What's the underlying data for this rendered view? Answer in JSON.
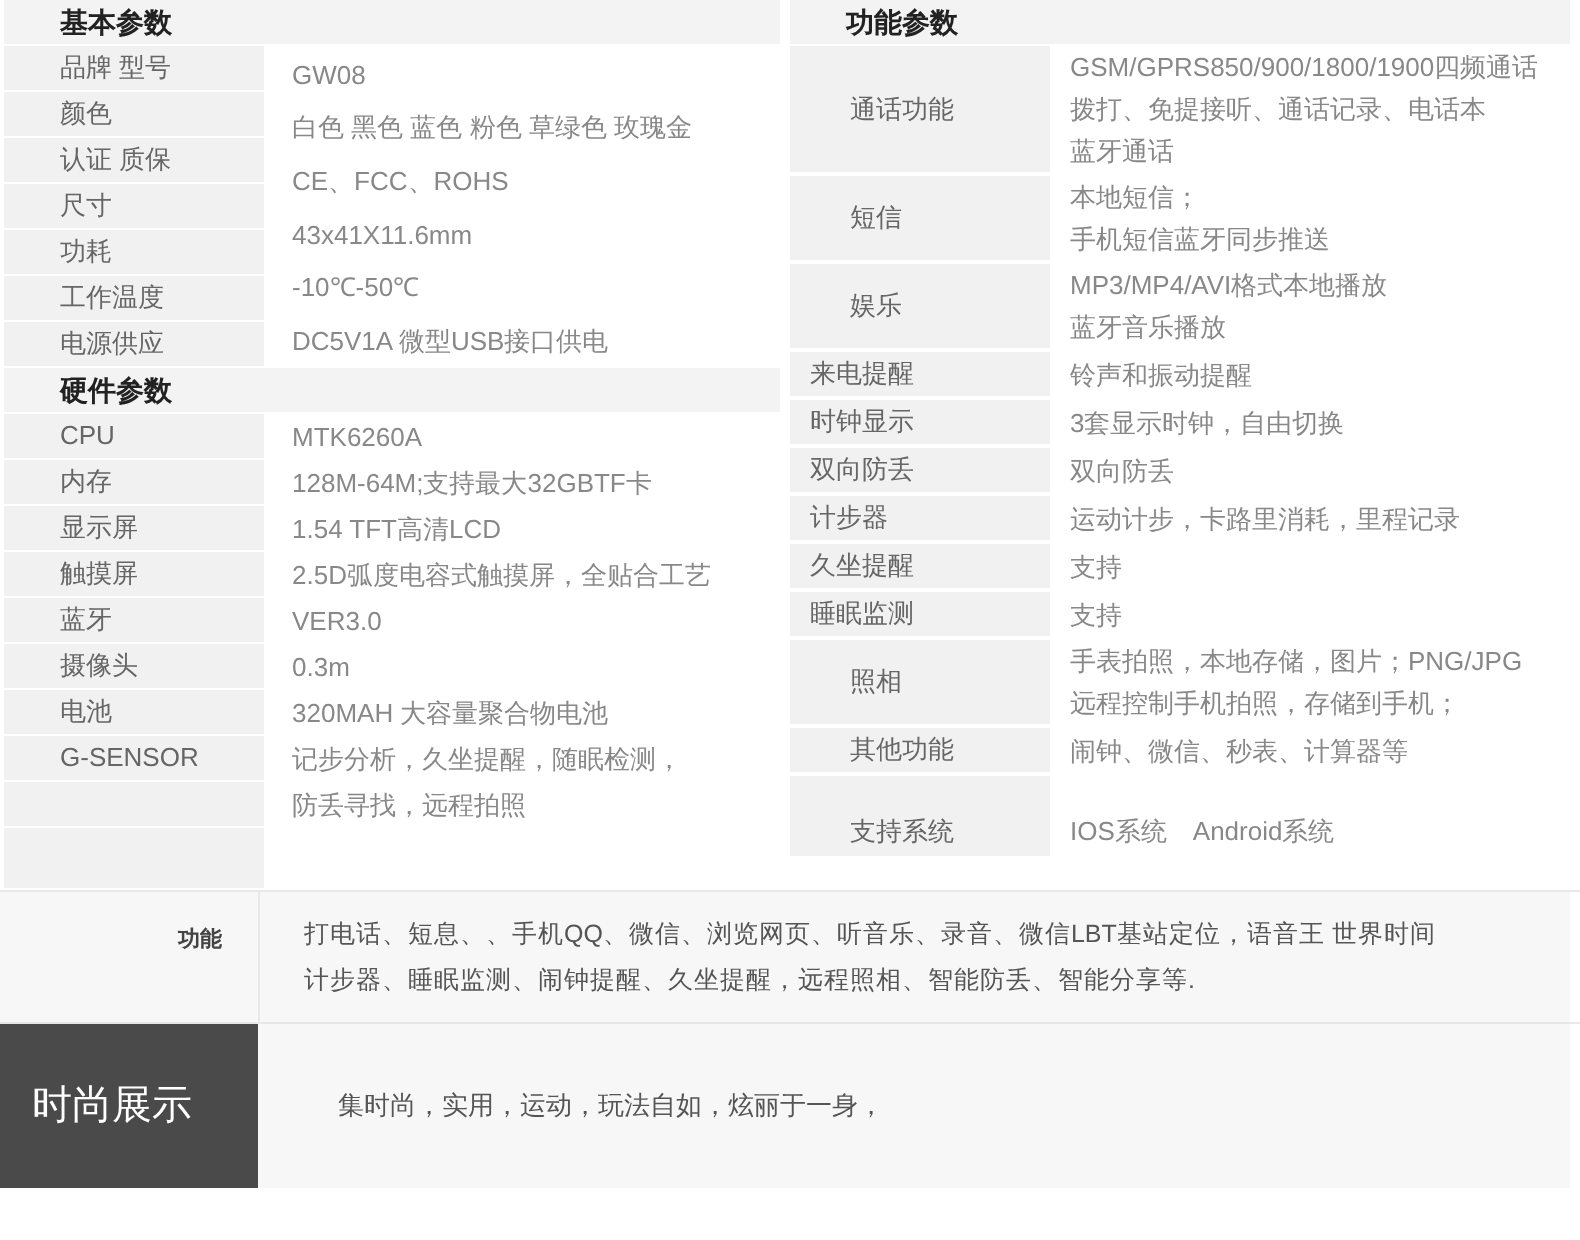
{
  "basic": {
    "title": "基本参数",
    "labels": [
      "品牌 型号",
      "颜色",
      "认证 质保",
      "尺寸",
      "功耗",
      "工作温度",
      "电源供应"
    ],
    "values": [
      "GW08",
      "白色 黑色 蓝色 粉色 草绿色 玫瑰金",
      "CE、FCC、ROHS",
      "43x41X11.6mm",
      "-10℃-50℃",
      "DC5V1A 微型USB接口供电"
    ]
  },
  "hardware": {
    "title": "硬件参数",
    "rows": [
      {
        "label": "CPU",
        "lines": [
          "MTK6260A"
        ]
      },
      {
        "label": "内存",
        "lines": [
          "128M-64M;支持最大32GBTF卡"
        ]
      },
      {
        "label": "显示屏",
        "lines": [
          "1.54 TFT高清LCD"
        ]
      },
      {
        "label": "触摸屏",
        "lines": [
          "2.5D弧度电容式触摸屏，全贴合工艺"
        ]
      },
      {
        "label": "蓝牙",
        "lines": [
          "VER3.0"
        ]
      },
      {
        "label": "摄像头",
        "lines": [
          "0.3m"
        ]
      },
      {
        "label": "电池",
        "lines": [
          "320MAH 大容量聚合物电池"
        ]
      },
      {
        "label": "G-SENSOR",
        "lines": [
          "记步分析，久坐提醒，随眠检测，",
          "防丢寻找，远程拍照"
        ]
      }
    ]
  },
  "functions": {
    "title": "功能参数",
    "rows": [
      {
        "kind": "tall",
        "label": "通话功能",
        "lines": [
          "GSM/GPRS850/900/1800/1900四频通话",
          "拨打、免提接听、通话记录、电话本",
          "蓝牙通话"
        ]
      },
      {
        "kind": "tall",
        "label": "短信",
        "lines": [
          "本地短信；",
          "手机短信蓝牙同步推送"
        ]
      },
      {
        "kind": "tall",
        "label": "娱乐",
        "lines": [
          "MP3/MP4/AVI格式本地播放",
          "蓝牙音乐播放"
        ]
      },
      {
        "kind": "compact",
        "label": "来电提醒",
        "lines": [
          "铃声和振动提醒"
        ]
      },
      {
        "kind": "compact",
        "label": "时钟显示",
        "lines": [
          "3套显示时钟，自由切换"
        ]
      },
      {
        "kind": "compact",
        "label": "双向防丢",
        "lines": [
          "双向防丢"
        ]
      },
      {
        "kind": "compact",
        "label": "计步器",
        "lines": [
          "运动计步，卡路里消耗，里程记录"
        ]
      },
      {
        "kind": "compact",
        "label": "久坐提醒",
        "lines": [
          "支持"
        ]
      },
      {
        "kind": "compact",
        "label": "睡眠监测",
        "lines": [
          "支持"
        ]
      },
      {
        "kind": "tall",
        "label": "照相",
        "lines": [
          "手表拍照，本地存储，图片；PNG/JPG",
          "远程控制手机拍照，存储到手机；"
        ]
      },
      {
        "kind": "tall",
        "label": "其他功能",
        "lines": [
          "闹钟、微信、秒表、计算器等"
        ]
      },
      {
        "kind": "system",
        "label": "支持系统",
        "lines": [
          "IOS系统　Android系统"
        ]
      }
    ]
  },
  "feature_row": {
    "label": "功能",
    "lines": [
      "打电话、短息、、手机QQ、微信、浏览网页、听音乐、录音、微信LBT基站定位，语音王  世界时间",
      "计步器、睡眠监测、闹钟提醒、久坐提醒，远程照相、智能防丢、智能分享等."
    ]
  },
  "showcase_row": {
    "label": "时尚展示",
    "text": "集时尚，实用，运动，玩法自如，炫丽于一身，"
  }
}
